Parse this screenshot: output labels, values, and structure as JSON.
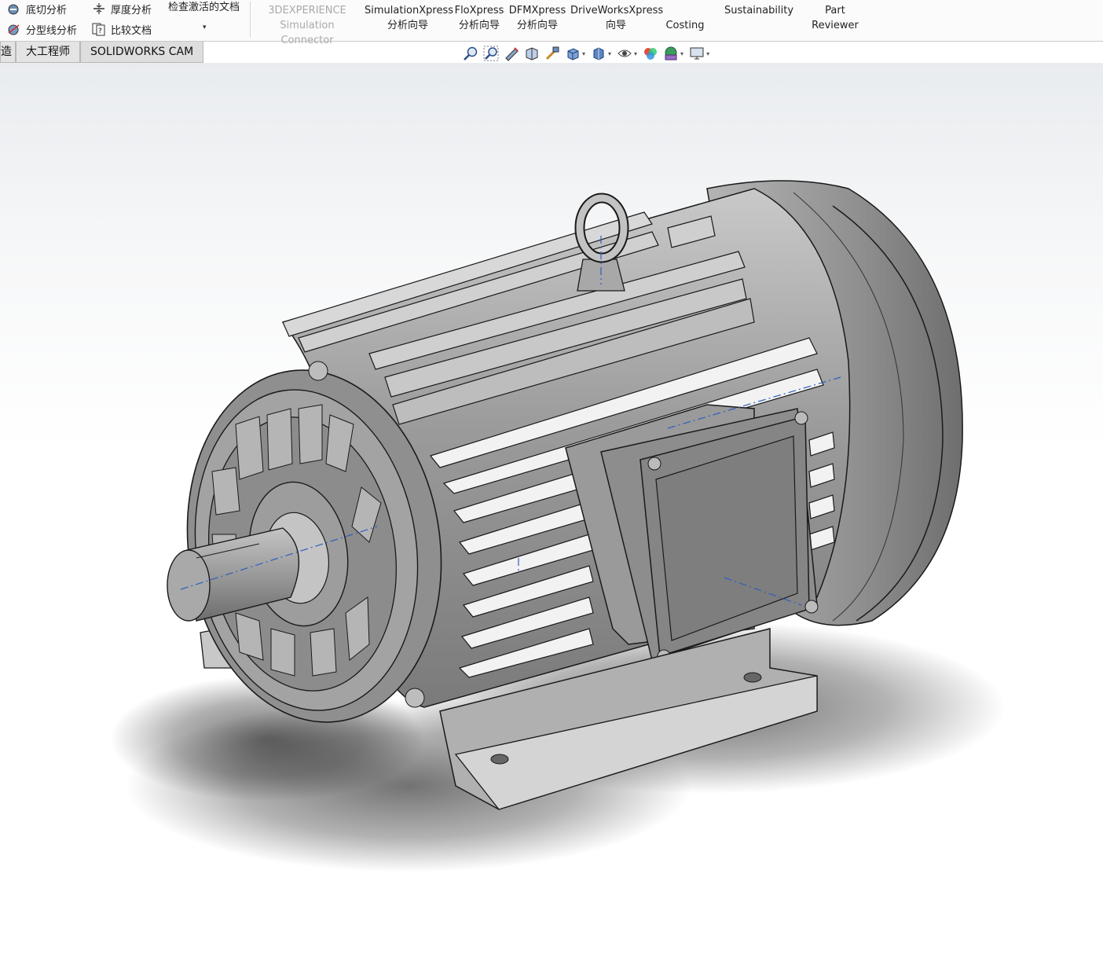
{
  "ribbon": {
    "left_tools": [
      {
        "label": "底切分析",
        "icon": "undercut-analysis-icon"
      },
      {
        "label": "分型线分析",
        "icon": "parting-line-analysis-icon"
      },
      {
        "label": "厚度分析",
        "icon": "thickness-analysis-icon"
      },
      {
        "label": "比较文档",
        "icon": "compare-documents-icon"
      },
      {
        "label": "检查激活的文档",
        "icon": "check-active-document-icon"
      }
    ],
    "big_buttons": [
      {
        "line1": "3DEXPERIENCE",
        "line2": "Simulation Connector",
        "disabled": true
      },
      {
        "line1": "SimulationXpress",
        "line2": "分析向导"
      },
      {
        "line1": "FloXpress",
        "line2": "分析向导"
      },
      {
        "line1": "DFMXpress",
        "line2": "分析向导"
      },
      {
        "line1": "DriveWorksXpress",
        "line2": "向导"
      },
      {
        "line1": "",
        "line2": "Costing"
      },
      {
        "line1": "Sustainability",
        "line2": ""
      },
      {
        "line1": "Part",
        "line2": "Reviewer"
      }
    ]
  },
  "tabs": [
    {
      "label": "造",
      "cut": true
    },
    {
      "label": "大工程师"
    },
    {
      "label": "SOLIDWORKS CAM",
      "active": true
    }
  ],
  "heads_up_toolbar": [
    "zoom-to-fit-icon",
    "zoom-to-area-icon",
    "previous-view-icon",
    "section-view-icon",
    "dynamic-annotation-icon",
    "view-orientation-icon",
    "display-style-icon",
    "hide-show-items-icon",
    "edit-appearance-icon",
    "apply-scene-icon",
    "view-settings-icon"
  ],
  "colors": {
    "accent_blue": "#2f5fbd",
    "model_gray": "#a3a3a3",
    "ribbon_bg": "#fbfbfb",
    "tab_bg": "#e4e4e4"
  }
}
